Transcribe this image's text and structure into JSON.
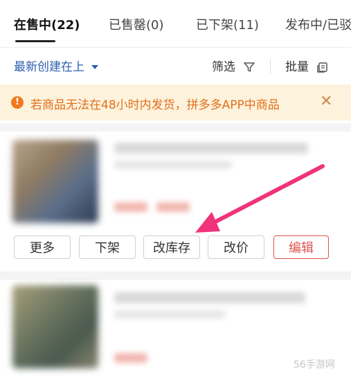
{
  "tabs": [
    {
      "label": "在售中(22)"
    },
    {
      "label": "已售罄(0)"
    },
    {
      "label": "已下架(11)"
    },
    {
      "label": "发布中/已驳"
    }
  ],
  "toolbar": {
    "sort_label": "最新创建在上",
    "filter_label": "筛选",
    "batch_label": "批量"
  },
  "notice": {
    "icon": "!",
    "text": "若商品无法在48小时内发货，拼多多APP中商品",
    "close": "✕"
  },
  "card_actions": {
    "more": "更多",
    "delist": "下架",
    "change_stock": "改库存",
    "change_price": "改价",
    "edit": "编辑"
  },
  "colors": {
    "accent_blue": "#2f5fb0",
    "notice_bg": "#fdf2dc",
    "notice_text": "#e2701b",
    "edit_red": "#d9534f",
    "arrow_pink": "#f0337a"
  },
  "watermark": "56手游网"
}
